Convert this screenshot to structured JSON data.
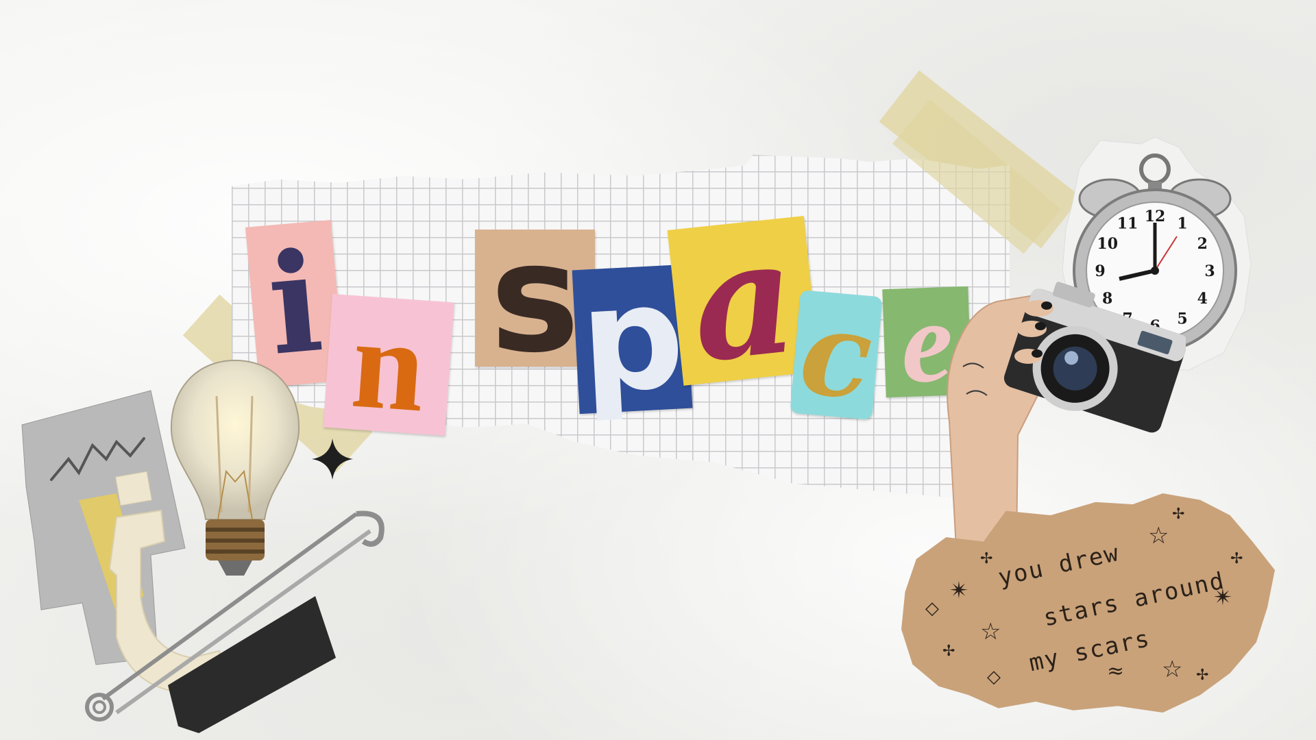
{
  "title": {
    "letters": [
      {
        "char": "i",
        "bg": "#f4b9b4",
        "fg": "#3a3563"
      },
      {
        "char": "n",
        "bg": "#f7c3d4",
        "fg": "#d96a12"
      },
      {
        "char": "s",
        "bg": "#d8b28f",
        "fg": "#3a2a24"
      },
      {
        "char": "p",
        "bg": "#2f4f9a",
        "fg": "#e8ecf4"
      },
      {
        "char": "a",
        "bg": "#efcf45",
        "fg": "#9b2a52"
      },
      {
        "char": "c",
        "bg": "#8ddadc",
        "fg": "#caa13a"
      },
      {
        "char": "e",
        "bg": "#86b870",
        "fg": "#f2c7c7"
      }
    ]
  },
  "note": {
    "lines": [
      "you drew",
      "stars around",
      "my scars"
    ]
  },
  "clock": {
    "numerals": [
      "12",
      "1",
      "2",
      "3",
      "4",
      "5",
      "6",
      "7",
      "8",
      "9",
      "10",
      "11"
    ]
  },
  "icons": {
    "bulb": "lightbulb-icon",
    "pin": "safety-pin-icon",
    "camera": "camera-icon",
    "clock": "alarm-clock-icon",
    "hand": "hand-icon",
    "sparkle": "sparkle-icon"
  },
  "colors": {
    "paper": "#f0f0ee",
    "tape": "#e0d5a0",
    "note": "#c9a27a",
    "ink": "#2b2118"
  }
}
